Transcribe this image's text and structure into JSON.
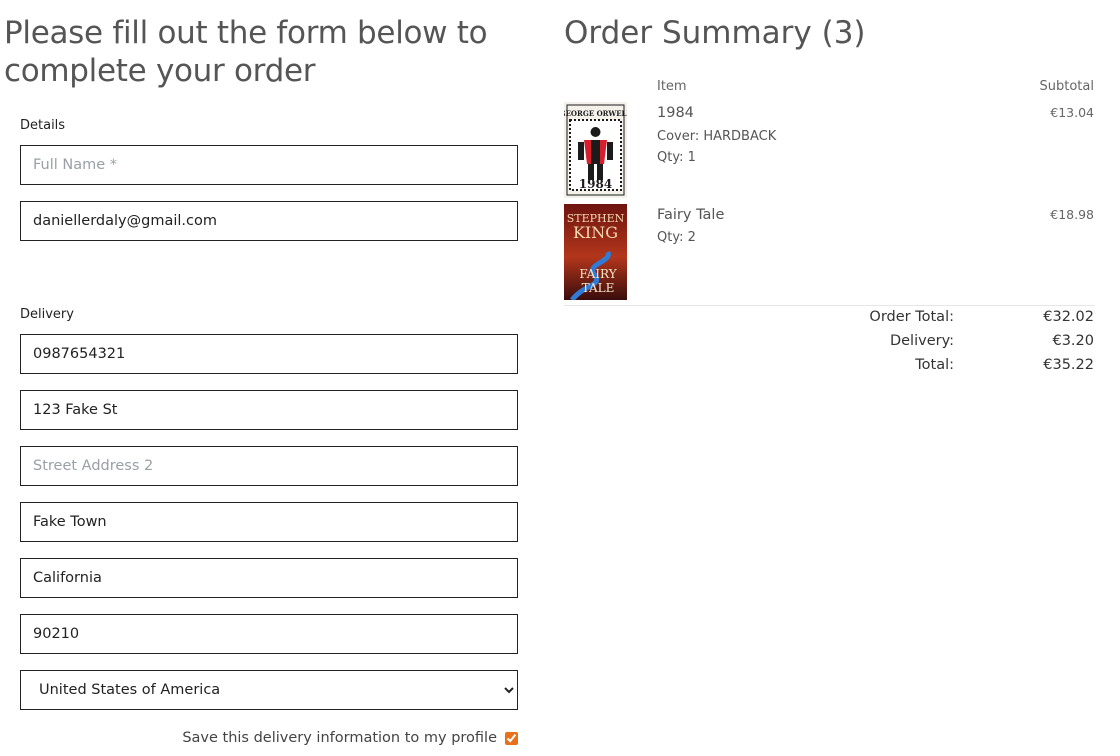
{
  "form": {
    "title": "Please fill out the form below to complete your order",
    "details_label": "Details",
    "full_name_placeholder": "Full Name *",
    "email_value": "daniellerdaly@gmail.com",
    "delivery_label": "Delivery",
    "phone_value": "0987654321",
    "street1_value": "123 Fake St",
    "street2_placeholder": "Street Address 2",
    "town_value": "Fake Town",
    "county_value": "California",
    "postcode_value": "90210",
    "country_selected": "United States of America",
    "save_label": "Save this delivery information to my profile",
    "save_checked": true,
    "accent_color": "#e8701a"
  },
  "summary": {
    "title": "Order Summary (3)",
    "col_item": "Item",
    "col_subtotal": "Subtotal",
    "items": [
      {
        "name": "1984",
        "cover_line": "Cover: HARDBACK",
        "qty": "Qty: 1",
        "subtotal": "€13.04",
        "cover_author": "GEORGE ORWELL",
        "cover_title": "1984"
      },
      {
        "name": "Fairy Tale",
        "qty": "Qty: 2",
        "subtotal": "€18.98",
        "cover_author_1": "STEPHEN",
        "cover_author_2": "KING",
        "cover_title_1": "FAIRY",
        "cover_title_2": "TALE"
      }
    ],
    "order_total_label": "Order Total:",
    "order_total_value": "€32.02",
    "delivery_label": "Delivery:",
    "delivery_value": "€3.20",
    "total_label": "Total:",
    "total_value": "€35.22"
  }
}
